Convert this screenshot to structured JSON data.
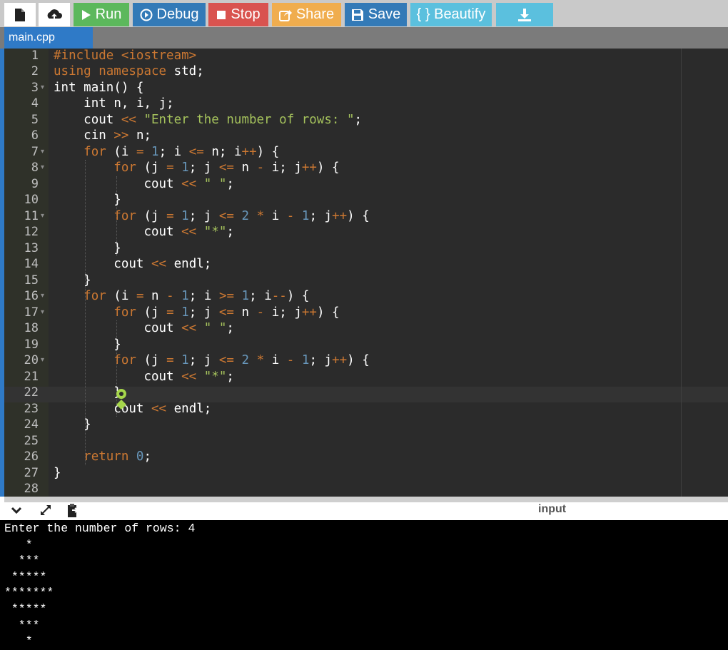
{
  "toolbar": {
    "buttons": [
      {
        "name": "new-file",
        "label": "",
        "color": "#ffffff",
        "icon": "file-icon"
      },
      {
        "name": "upload",
        "label": "",
        "color": "#ffffff",
        "icon": "upload-icon"
      },
      {
        "name": "run",
        "label": "Run",
        "color": "#5cb85c",
        "icon": "play-icon"
      },
      {
        "name": "debug",
        "label": "Debug",
        "color": "#337ab7",
        "icon": "debug-icon"
      },
      {
        "name": "stop",
        "label": "Stop",
        "color": "#d9534f",
        "icon": "stop-icon"
      },
      {
        "name": "share",
        "label": "Share",
        "color": "#f0ad4e",
        "icon": "share-icon"
      },
      {
        "name": "save",
        "label": "Save",
        "color": "#337ab7",
        "icon": "save-icon"
      },
      {
        "name": "beautify",
        "label": "{ } Beautify",
        "color": "#5bc0de",
        "icon": ""
      },
      {
        "name": "download",
        "label": "",
        "color": "#5bc0de",
        "icon": "download-icon"
      }
    ]
  },
  "tabs": [
    {
      "label": "main.cpp",
      "active": true
    }
  ],
  "editor": {
    "language": "cpp",
    "active_line": 22,
    "lines": [
      {
        "n": "1",
        "fold": false
      },
      {
        "n": "2",
        "fold": false
      },
      {
        "n": "3",
        "fold": true
      },
      {
        "n": "4",
        "fold": false
      },
      {
        "n": "5",
        "fold": false
      },
      {
        "n": "6",
        "fold": false
      },
      {
        "n": "7",
        "fold": true
      },
      {
        "n": "8",
        "fold": true
      },
      {
        "n": "9",
        "fold": false
      },
      {
        "n": "10",
        "fold": false
      },
      {
        "n": "11",
        "fold": true
      },
      {
        "n": "12",
        "fold": false
      },
      {
        "n": "13",
        "fold": false
      },
      {
        "n": "14",
        "fold": false
      },
      {
        "n": "15",
        "fold": false
      },
      {
        "n": "16",
        "fold": true
      },
      {
        "n": "17",
        "fold": true
      },
      {
        "n": "18",
        "fold": false
      },
      {
        "n": "19",
        "fold": false
      },
      {
        "n": "20",
        "fold": true
      },
      {
        "n": "21",
        "fold": false
      },
      {
        "n": "22",
        "fold": false
      },
      {
        "n": "23",
        "fold": false
      },
      {
        "n": "24",
        "fold": false
      },
      {
        "n": "25",
        "fold": false
      },
      {
        "n": "26",
        "fold": false
      },
      {
        "n": "27",
        "fold": false
      },
      {
        "n": "28",
        "fold": false
      }
    ],
    "code": [
      "#include <iostream>",
      "using namespace std;",
      "int main() {",
      "    int n, i, j;",
      "    cout << \"Enter the number of rows: \";",
      "    cin >> n;",
      "    for (i = 1; i <= n; i++) {",
      "        for (j = 1; j <= n - i; j++) {",
      "            cout << \" \";",
      "        }",
      "        for (j = 1; j <= 2 * i - 1; j++) {",
      "            cout << \"*\";",
      "        }",
      "        cout << endl;",
      "    }",
      "    for (i = n - 1; i >= 1; i--) {",
      "        for (j = 1; j <= n - i; j++) {",
      "            cout << \" \";",
      "        }",
      "        for (j = 1; j <= 2 * i - 1; j++) {",
      "            cout << \"*\";",
      "        }",
      "        cout << endl;",
      "    }",
      "",
      "    return 0;",
      "}",
      ""
    ]
  },
  "output_panel": {
    "input_label": "input",
    "console_lines": [
      "Enter the number of rows: 4",
      "   *",
      "  ***",
      " *****",
      "*******",
      " *****",
      "  ***",
      "   *"
    ]
  }
}
